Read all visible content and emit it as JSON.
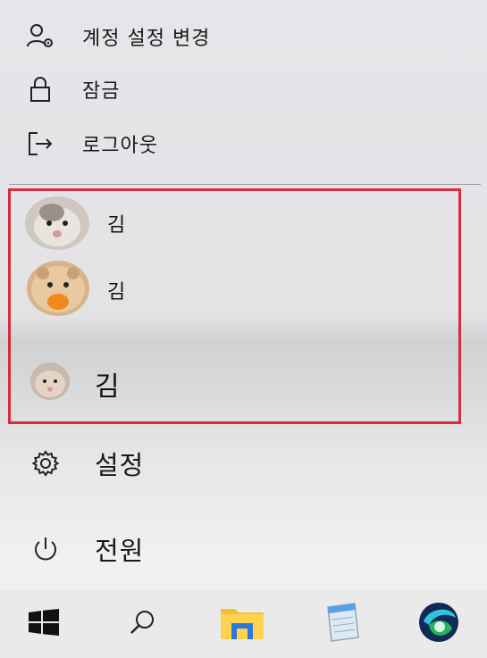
{
  "menu": {
    "account_settings": "계정 설정 변경",
    "lock": "잠금",
    "sign_out": "로그아웃",
    "settings": "설정",
    "power": "전원"
  },
  "accounts": [
    {
      "name": "김"
    },
    {
      "name": "김"
    },
    {
      "name": "김"
    }
  ],
  "colors": {
    "highlight": "#d92b3a",
    "divider": "#9a9a9a"
  },
  "icons": {
    "account_settings": "person-gear-icon",
    "lock": "lock-icon",
    "sign_out": "sign-out-icon",
    "settings": "gear-icon",
    "power": "power-icon",
    "start": "windows-logo-icon",
    "search": "search-icon",
    "explorer": "folder-icon",
    "notepad": "notepad-icon",
    "browser": "browser-icon"
  }
}
